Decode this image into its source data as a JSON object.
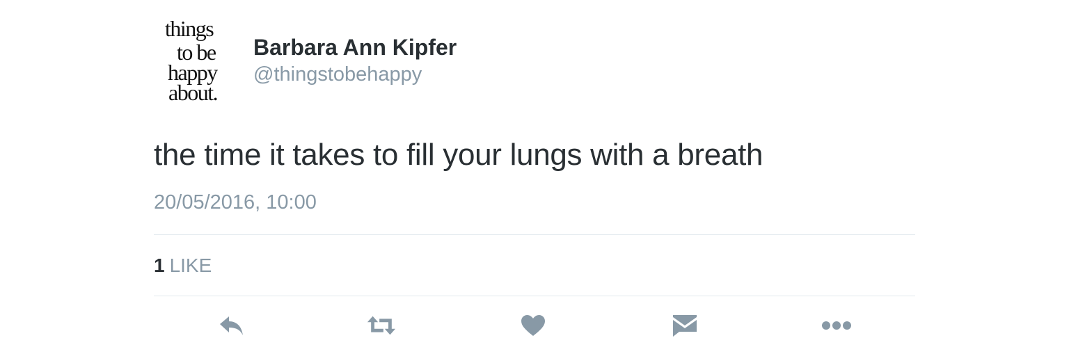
{
  "user": {
    "avatar_text": [
      "things",
      "to be",
      "happy",
      "about."
    ],
    "name": "Barbara Ann Kipfer",
    "handle": "@thingstobehappy"
  },
  "tweet": {
    "text": "the time it takes to fill your lungs with a breath",
    "timestamp": "20/05/2016, 10:00"
  },
  "stats": {
    "likes_count": "1",
    "likes_label": "LIKE"
  },
  "actions": {
    "reply_icon": "reply-icon",
    "retweet_icon": "retweet-icon",
    "like_icon": "heart-icon",
    "dm_icon": "envelope-icon",
    "more_icon": "more-dots-icon"
  },
  "colors": {
    "text_primary": "#292f33",
    "text_secondary": "#8899a6",
    "icon": "#8899a6",
    "divider": "#e1e8ed"
  }
}
